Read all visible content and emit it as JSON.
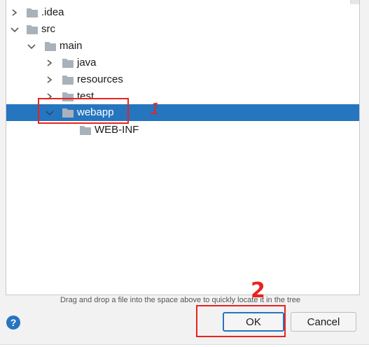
{
  "tree": {
    "items": [
      {
        "label": ".idea",
        "expanded": false,
        "has_children": true,
        "depth": 0
      },
      {
        "label": "src",
        "expanded": true,
        "has_children": true,
        "depth": 0
      },
      {
        "label": "main",
        "expanded": true,
        "has_children": true,
        "depth": 1
      },
      {
        "label": "java",
        "expanded": false,
        "has_children": true,
        "depth": 2
      },
      {
        "label": "resources",
        "expanded": false,
        "has_children": true,
        "depth": 2
      },
      {
        "label": "test",
        "expanded": false,
        "has_children": true,
        "depth": 2
      },
      {
        "label": "webapp",
        "expanded": true,
        "has_children": true,
        "depth": 2,
        "selected": true
      },
      {
        "label": "WEB-INF",
        "expanded": false,
        "has_children": false,
        "depth": 3
      }
    ]
  },
  "annotations": {
    "step1": "1",
    "step2": "2"
  },
  "hint_text": "Drag and drop a file into the space above to quickly locate it in the tree",
  "buttons": {
    "help": "?",
    "ok": "OK",
    "cancel": "Cancel"
  },
  "colors": {
    "selection": "#2675bf",
    "annotation": "#e8231f",
    "folder": "#a9b2bb"
  }
}
